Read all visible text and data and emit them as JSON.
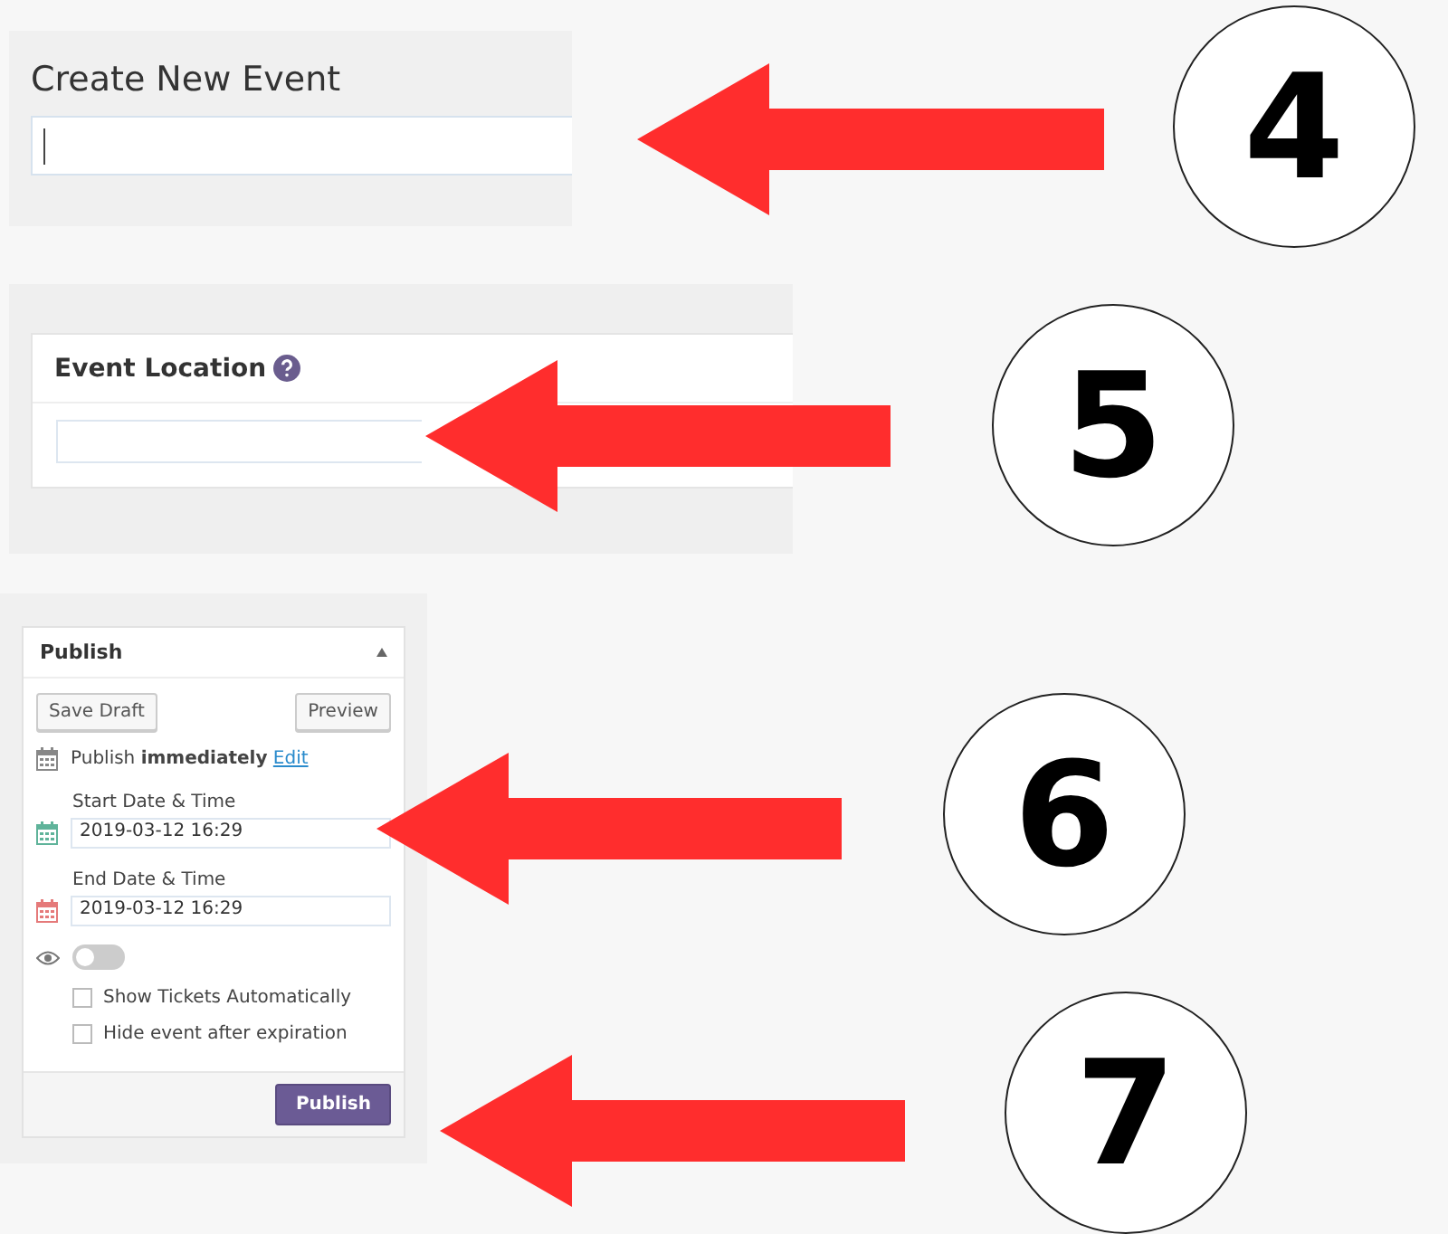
{
  "title_panel": {
    "heading": "Create New Event"
  },
  "location_panel": {
    "heading": "Event Location"
  },
  "publish_panel": {
    "heading": "Publish",
    "expanded": true,
    "save_button": "Save Draft",
    "preview_button": "Preview",
    "status": "Publish **immediately**",
    "edit_link": "Edit",
    "dates": [
      {
        "label": "Start Date & Time",
        "value": "2019-03-12 16:29",
        "color": "#5fb39a"
      },
      {
        "label": "End Date & Time",
        "value": "2019-03-12 16:29",
        "color": "#e57a7a"
      }
    ],
    "visibility_toggle": {
      "on": false
    },
    "options": [
      {
        "label": "Show Tickets Automatically",
        "checked": false
      },
      {
        "label": "Hide event after expiration",
        "checked": false
      }
    ],
    "publish_button": "Publish"
  },
  "steps": [
    {
      "number": "4"
    },
    {
      "number": "5"
    },
    {
      "number": "6"
    },
    {
      "number": "7"
    }
  ]
}
